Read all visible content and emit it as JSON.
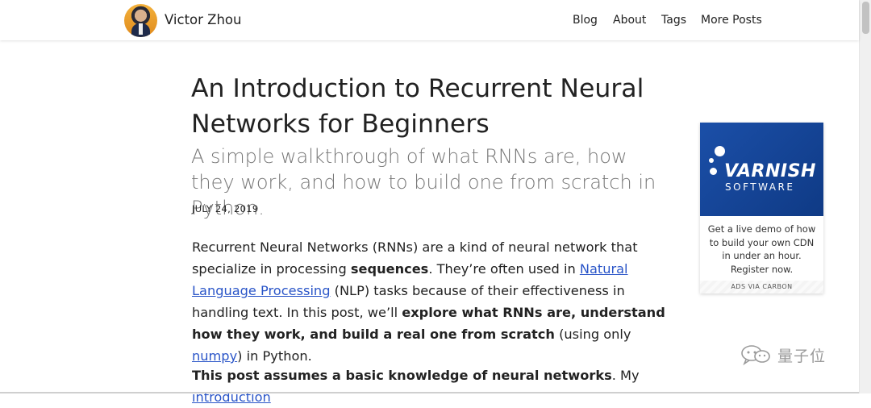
{
  "header": {
    "site_name": "Victor Zhou",
    "nav": [
      "Blog",
      "About",
      "Tags",
      "More Posts"
    ]
  },
  "article": {
    "title": "An Introduction to Recurrent Neural Networks for Beginners",
    "subtitle": "A simple walkthrough of what RNNs are, how they work, and how to build one from scratch in Python.",
    "date": "JULY 24, 2019",
    "p1": {
      "t1": "Recurrent Neural Networks (RNNs) are a kind of neural network that specialize in processing ",
      "b1": "sequences",
      "t2": ". They’re often used in ",
      "link1": "Natural Language Processing",
      "t3": " (NLP) tasks because of their effectiveness in handling text. In this post, we’ll ",
      "b2": "explore what RNNs are, understand how they work, and build a real one from scratch",
      "t4": " (using only ",
      "link2": "numpy",
      "t5": ") in Python."
    },
    "p2": {
      "b1": "This post assumes a basic knowledge of neural networks",
      "t1": ". My ",
      "link1": "introduction"
    }
  },
  "ad": {
    "brand_main": "VARNISH",
    "brand_sub": "SOFTWARE",
    "text": "Get a live demo of how to build your own CDN in under an hour. Register now.",
    "footer": "ADS VIA CARBON"
  },
  "watermark": {
    "text": "量子位",
    "icon": "wechat-icon"
  },
  "colors": {
    "link": "#2a55c8",
    "ad_blue": "#1b4fa8",
    "subtitle_gray": "#777777"
  }
}
